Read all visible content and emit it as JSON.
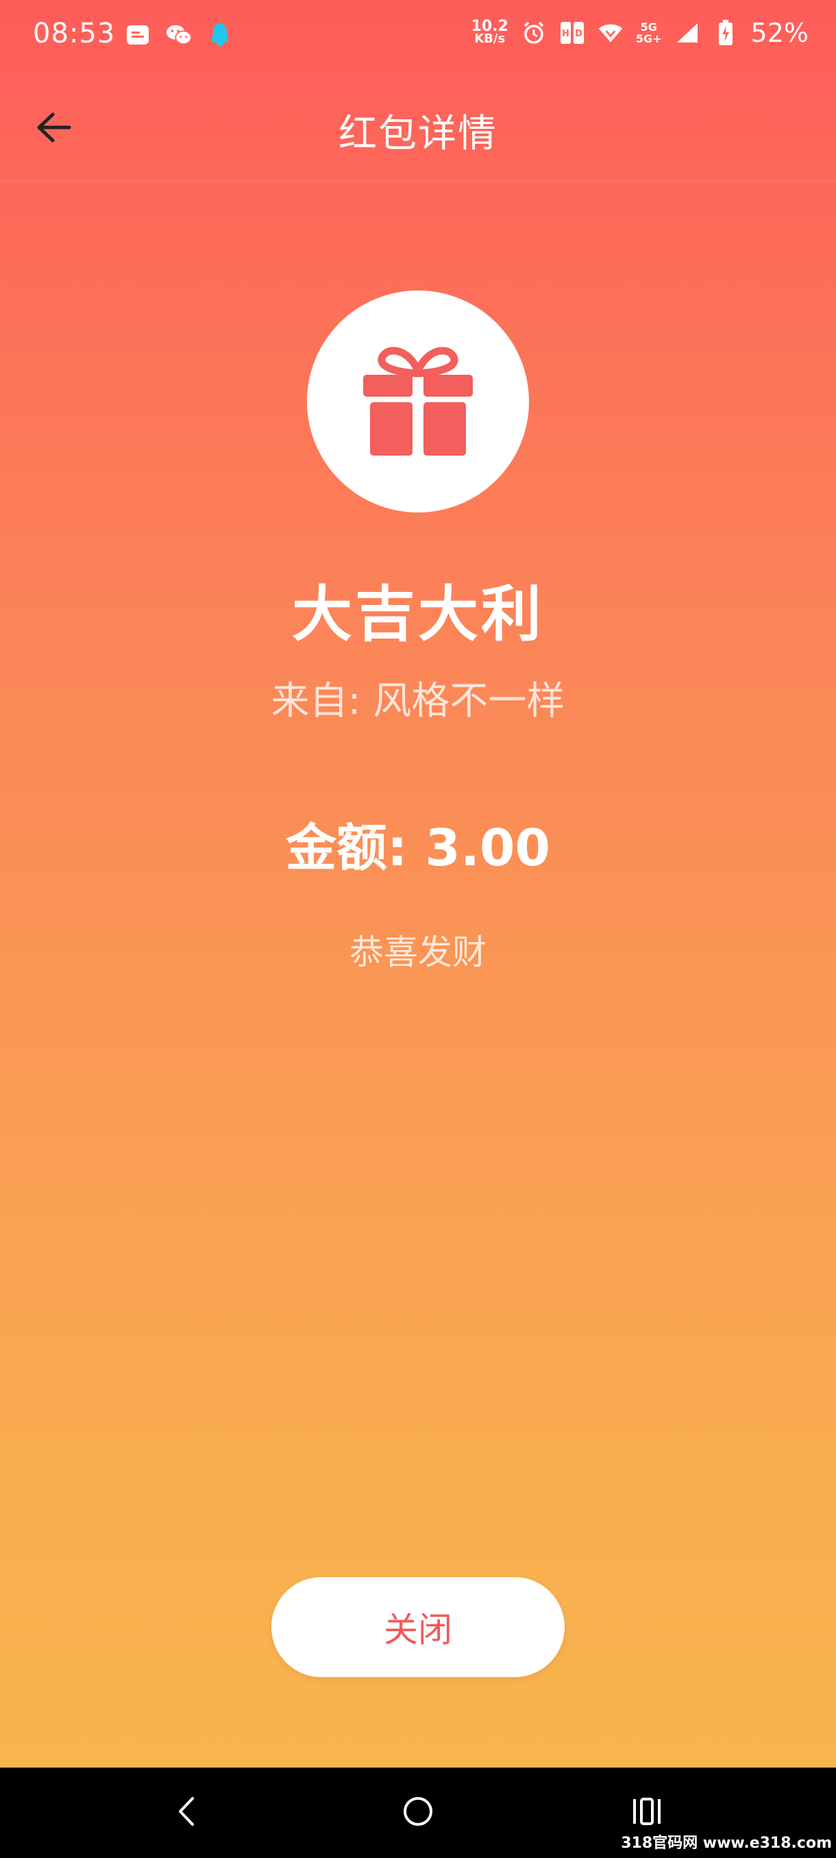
{
  "status_bar": {
    "time": "08:53",
    "net_speed_value": "10.2",
    "net_speed_unit": "KB/s",
    "signal_top": "5G",
    "signal_bottom": "5G+",
    "battery": "52%",
    "left_icons": [
      "message-notification-icon",
      "wechat-icon",
      "qq-icon"
    ],
    "right_icons": [
      "alarm-icon",
      "sim-hd-icon",
      "wifi-icon",
      "signal-icon",
      "battery-charging-icon"
    ]
  },
  "header": {
    "title": "红包详情",
    "back_icon": "back-arrow-icon"
  },
  "packet": {
    "icon": "gift-icon",
    "title": "大吉大利",
    "from": "来自: 风格不一样",
    "amount": "金额: 3.00",
    "wish": "恭喜发财"
  },
  "actions": {
    "close_label": "关闭"
  },
  "nav_bar": {
    "icons": [
      "nav-back-icon",
      "nav-home-icon",
      "nav-recents-icon"
    ]
  },
  "watermark": "318官码网 www.e318.com",
  "colors": {
    "gradient_top": "#fe5d59",
    "gradient_bottom": "#f8b44d",
    "accent_red": "#ee5c5a"
  }
}
